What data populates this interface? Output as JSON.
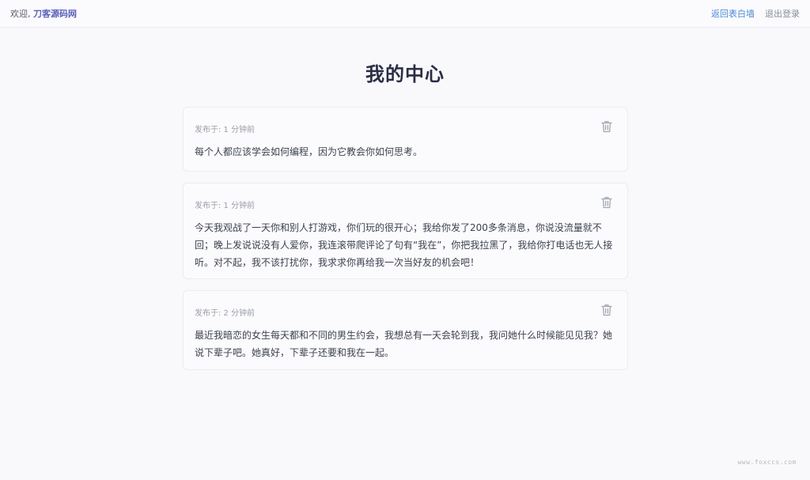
{
  "header": {
    "welcome_prefix": "欢迎, ",
    "username": "刀客源码网",
    "back_link": "返回表白墙",
    "logout_link": "退出登录"
  },
  "page": {
    "title": "我的中心"
  },
  "posts": [
    {
      "meta": "发布于: 1 分钟前",
      "content": "每个人都应该学会如何编程，因为它教会你如何思考。"
    },
    {
      "meta": "发布于: 1 分钟前",
      "content": "今天我观战了一天你和别人打游戏，你们玩的很开心；我给你发了200多条消息，你说没流量就不回；晚上发说说没有人爱你，我连滚带爬评论了句有“我在”，你把我拉黑了，我给你打电话也无人接听。对不起，我不该打扰你，我求求你再给我一次当好友的机会吧！"
    },
    {
      "meta": "发布于: 2 分钟前",
      "content": "最近我暗恋的女生每天都和不同的男生约会，我想总有一天会轮到我，我问她什么时候能见见我？她说下辈子吧。她真好，下辈子还要和我在一起。"
    }
  ],
  "icons": {
    "delete": "trash-icon"
  },
  "colors": {
    "accent_link": "#4b8bd4",
    "username": "#5b5fb8",
    "title": "#2a2e45"
  },
  "watermark": "www.foxccs.com"
}
